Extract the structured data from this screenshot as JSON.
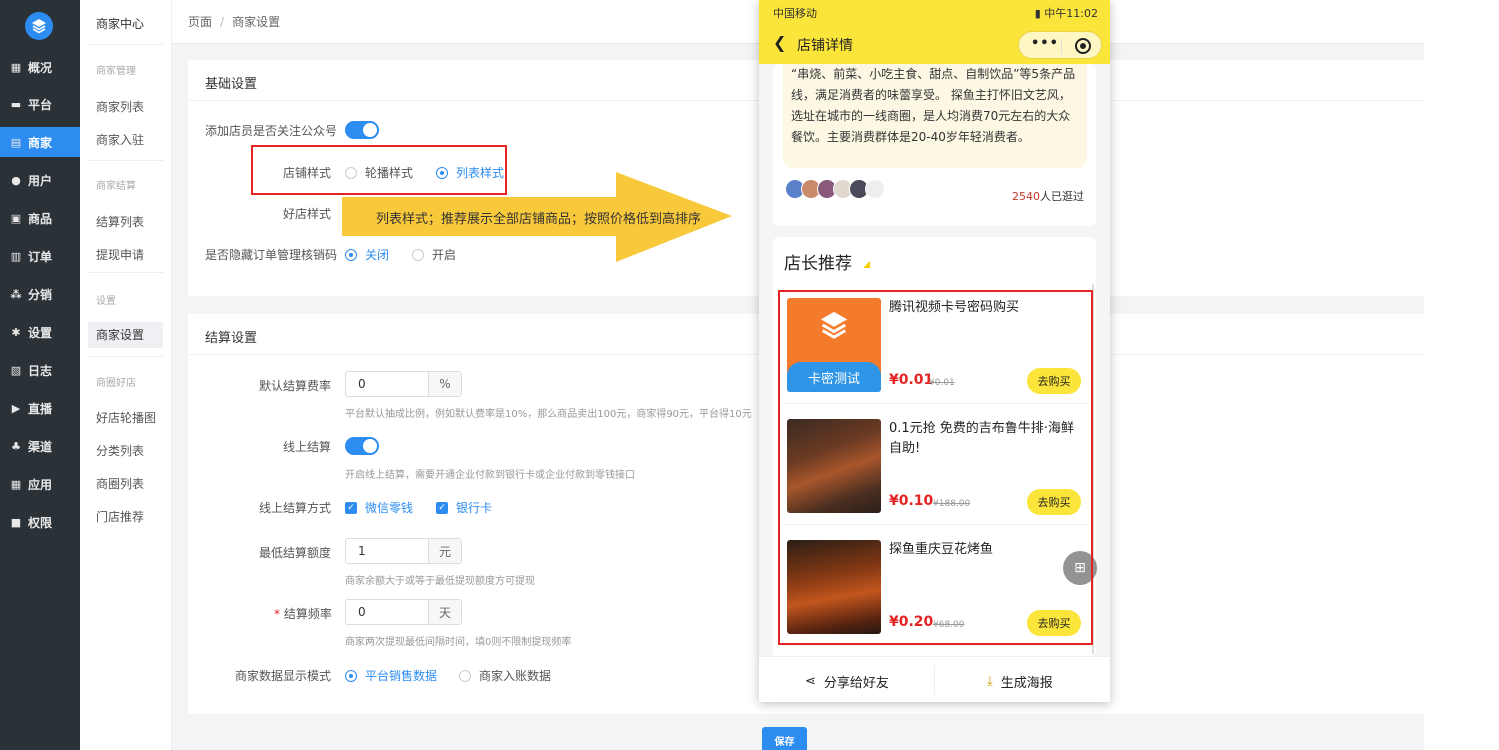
{
  "nav": {
    "items": [
      {
        "label": "概况",
        "icon": "dashboard-icon"
      },
      {
        "label": "平台",
        "icon": "monitor-icon"
      },
      {
        "label": "商家",
        "icon": "store-icon"
      },
      {
        "label": "用户",
        "icon": "user-icon"
      },
      {
        "label": "商品",
        "icon": "goods-icon"
      },
      {
        "label": "订单",
        "icon": "order-icon"
      },
      {
        "label": "分销",
        "icon": "distribution-icon"
      },
      {
        "label": "设置",
        "icon": "gear-icon"
      },
      {
        "label": "日志",
        "icon": "log-icon"
      },
      {
        "label": "直播",
        "icon": "live-icon"
      },
      {
        "label": "渠道",
        "icon": "channel-icon"
      },
      {
        "label": "应用",
        "icon": "apps-icon"
      },
      {
        "label": "权限",
        "icon": "lock-icon"
      }
    ],
    "active_index": 2
  },
  "subnav": {
    "title": "商家中心",
    "groups": [
      {
        "title": "商家管理",
        "items": [
          "商家列表",
          "商家入驻"
        ]
      },
      {
        "title": "商家结算",
        "items": [
          "结算列表",
          "提现申请"
        ]
      },
      {
        "title": "设置",
        "items": [
          "商家设置"
        ]
      },
      {
        "title": "商圈好店",
        "items": [
          "好店轮播图",
          "分类列表",
          "商圈列表",
          "门店推荐"
        ]
      }
    ]
  },
  "breadcrumb": {
    "root": "页面",
    "sep": "/",
    "current": "商家设置"
  },
  "basic": {
    "title": "基础设置",
    "follow_label": "添加店员是否关注公众号",
    "store_style_label": "店铺样式",
    "store_style_options": [
      "轮播样式",
      "列表样式"
    ],
    "good_store_label": "好店样式",
    "hide_code_label": "是否隐藏订单管理核销码",
    "hide_code_options": [
      "关闭",
      "开启"
    ]
  },
  "settle": {
    "title": "结算设置",
    "rate_label": "默认结算费率",
    "rate_value": "0",
    "rate_unit": "%",
    "rate_hint": "平台默认抽成比例，例如默认费率是10%，那么商品卖出100元，商家得90元，平台得10元",
    "online_label": "线上结算",
    "online_hint": "开启线上结算，需要开通企业付款到银行卡或企业付款到零钱接口",
    "method_label": "线上结算方式",
    "methods": [
      "微信零钱",
      "银行卡"
    ],
    "min_label": "最低结算额度",
    "min_value": "1",
    "min_unit": "元",
    "min_hint": "商家余额大于或等于最低提现额度方可提现",
    "freq_star": "*",
    "freq_label": "结算频率",
    "freq_value": "0",
    "freq_unit": "天",
    "freq_hint": "商家两次提现最低间隔时间，填0则不限制提现频率",
    "display_label": "商家数据显示模式",
    "display_options": [
      "平台销售数据",
      "商家入账数据"
    ]
  },
  "annotation": "列表样式；推荐展示全部店铺商品；按照价格低到高排序",
  "save_label": "保存",
  "phone": {
    "carrier": "中国移动",
    "time": "中午11:02",
    "title": "店铺详情",
    "more": "•••",
    "description": "“串烧、前菜、小吃主食、甜点、自制饮品”等5条产品线，满足消费者的味蕾享受。 探鱼主打怀旧文艺风，选址在城市的一线商圈，是人均消费70元左右的大众餐饮。主要消费群体是20-40岁年轻消费者。",
    "visited_count": "2540",
    "visited_suffix": "人已逛过",
    "recommend_title": "店长推荐",
    "products": [
      {
        "name": "腾讯视频卡号密码购买",
        "price": "¥0.01",
        "orig": "¥0.01",
        "buy": "去购买",
        "badge": "卡密测试"
      },
      {
        "name": "0.1元抢 免费的吉布鲁牛排·海鲜自助!",
        "price": "¥0.10",
        "orig": "¥188.00",
        "buy": "去购买"
      },
      {
        "name": "探鱼重庆豆花烤鱼",
        "price": "¥0.20",
        "orig": "¥68.00",
        "buy": "去购买"
      }
    ],
    "share_label": "分享给好友",
    "poster_label": "生成海报"
  },
  "colors": {
    "primary": "#2d8cf0",
    "sidebar": "#2a3137",
    "accent_yellow": "#fce53a",
    "annotation_yellow": "#f9c93c",
    "red": "#e52323"
  }
}
